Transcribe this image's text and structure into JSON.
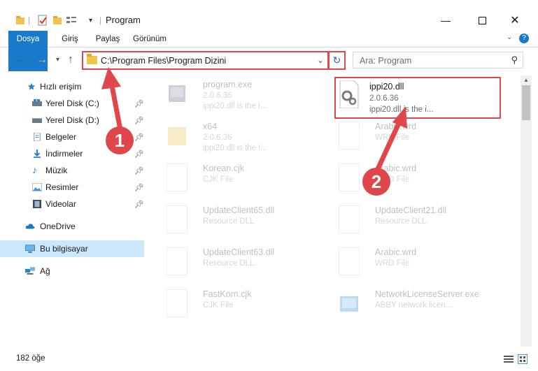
{
  "window": {
    "title": "Program"
  },
  "ribbon": {
    "tabs": [
      "Dosya",
      "Giriş",
      "Paylaş",
      "Görünüm"
    ]
  },
  "address": {
    "path": "C:\\Program Files\\Program Dizini"
  },
  "search": {
    "placeholder": "Ara: Program"
  },
  "sidebar": {
    "items": [
      {
        "label": "Hızlı erişim"
      },
      {
        "label": "Yerel Disk (C:)"
      },
      {
        "label": "Yerel Disk (D:)"
      },
      {
        "label": "Belgeler"
      },
      {
        "label": "İndirmeler"
      },
      {
        "label": "Müzik"
      },
      {
        "label": "Resimler"
      },
      {
        "label": "Videolar"
      },
      {
        "label": "OneDrive"
      },
      {
        "label": "Bu bilgisayar"
      },
      {
        "label": "Ağ"
      }
    ]
  },
  "files": [
    {
      "name": "program.exe",
      "sub": "2.0.6.36",
      "sub2": "ippi20.dll is the i..."
    },
    {
      "name": "ippi20.dll",
      "sub": "2.0.6.36",
      "sub2": "ippi20.dll is the i..."
    },
    {
      "name": "x64",
      "sub": "2.0.6.36",
      "sub2": "ippi20.dll is the i..."
    },
    {
      "name": "Arabic.wrd",
      "sub": "WRD File",
      "sub2": ""
    },
    {
      "name": "Korean.cjk",
      "sub": "CJK File",
      "sub2": ""
    },
    {
      "name": "Arabic.wrd",
      "sub": "WRD File",
      "sub2": ""
    },
    {
      "name": "UpdateClient65.dll",
      "sub": "Resource DLL",
      "sub2": ""
    },
    {
      "name": "UpdateClient21.dll",
      "sub": "Resource DLL",
      "sub2": ""
    },
    {
      "name": "UpdateClient63.dll",
      "sub": "Resource DLL",
      "sub2": ""
    },
    {
      "name": "Arabic.wrd",
      "sub": "WRD File",
      "sub2": ""
    },
    {
      "name": "FastKorn.cjk",
      "sub": "CJK File",
      "sub2": ""
    },
    {
      "name": "NetworkLicenseServer.exe",
      "sub": "ABBY network licen...",
      "sub2": ""
    }
  ],
  "status": {
    "count": "182 öğe"
  },
  "annotations": {
    "step1": "1",
    "step2": "2"
  },
  "colors": {
    "accent": "#1979ca",
    "highlight": "#e0474c",
    "selected": "#cce8ff"
  }
}
